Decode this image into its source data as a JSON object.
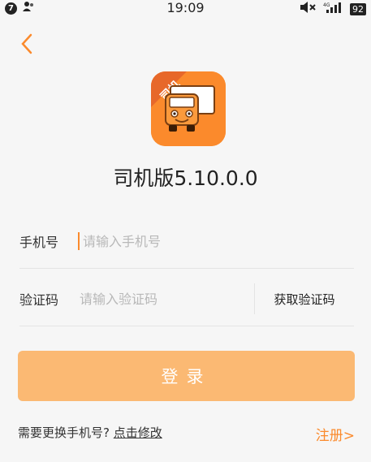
{
  "status_bar": {
    "notification_count": "7",
    "time": "19:09",
    "battery": "92",
    "signal_label": "4G"
  },
  "header": {
    "app_title": "司机版5.10.0.0",
    "logo_badge": "司机"
  },
  "form": {
    "phone": {
      "label": "手机号",
      "placeholder": "请输入手机号",
      "value": ""
    },
    "code": {
      "label": "验证码",
      "placeholder": "请输入验证码",
      "value": ""
    },
    "get_code_label": "获取验证码"
  },
  "login_label": "登录",
  "footer": {
    "change_question": "需要更换手机号?",
    "change_link": "点击修改",
    "register_label": "注册>"
  },
  "colors": {
    "accent": "#fb8a2c",
    "login_button": "#fbb973",
    "background": "#f6f6f6"
  },
  "icons": [
    "back-chevron-icon",
    "notification-icon",
    "contacts-icon",
    "mute-icon",
    "signal-icon",
    "battery-icon",
    "truck-logo-icon"
  ]
}
